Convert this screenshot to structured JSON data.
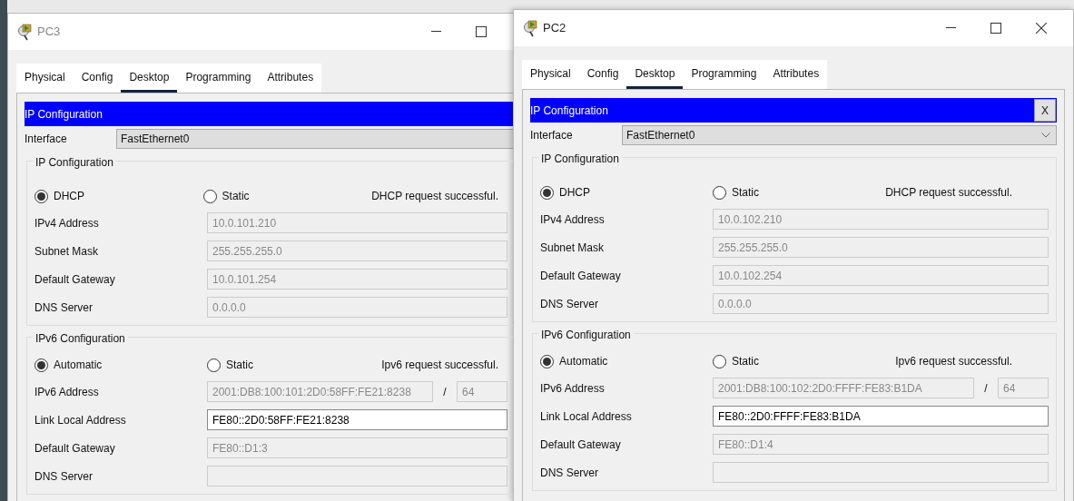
{
  "windows": [
    {
      "title": "PC3",
      "controls": [
        {
          "kind": "minimize"
        },
        {
          "kind": "maximize"
        }
      ],
      "tabs": [
        {
          "label": "Physical",
          "selected": false
        },
        {
          "label": "Config",
          "selected": false
        },
        {
          "label": "Desktop",
          "selected": true
        },
        {
          "label": "Programming",
          "selected": false
        },
        {
          "label": "Attributes",
          "selected": false
        }
      ],
      "panel": {
        "title": "IP Configuration",
        "interface_label": "Interface",
        "interface_value": "FastEthernet0",
        "dropdown": false,
        "ipv4": {
          "legend": "IP Configuration",
          "modes": [
            {
              "label": "DHCP",
              "selected": true
            },
            {
              "label": "Static",
              "selected": false
            }
          ],
          "status": "DHCP request successful.",
          "fields": [
            {
              "label": "IPv4 Address",
              "value": "10.0.101.210",
              "disabled": true
            },
            {
              "label": "Subnet Mask",
              "value": "255.255.255.0",
              "disabled": true
            },
            {
              "label": "Default Gateway",
              "value": "10.0.101.254",
              "disabled": true
            },
            {
              "label": "DNS Server",
              "value": "0.0.0.0",
              "disabled": true
            }
          ]
        },
        "ipv6": {
          "legend": "IPv6 Configuration",
          "modes": [
            {
              "label": "Automatic",
              "selected": true
            },
            {
              "label": "Static",
              "selected": false
            }
          ],
          "status": "Ipv6 request successful.",
          "fields": [
            {
              "label": "IPv6 Address",
              "value": "2001:DB8:100:101:2D0:58FF:FE21:8238",
              "disabled": true,
              "separator": "/",
              "prefix": "64"
            },
            {
              "label": "Link Local Address",
              "value": "FE80::2D0:58FF:FE21:8238",
              "disabled": false
            },
            {
              "label": "Default Gateway",
              "value": "FE80::D1:3",
              "disabled": true
            },
            {
              "label": "DNS Server",
              "disabled": true
            }
          ]
        }
      }
    },
    {
      "title": "PC2",
      "controls": [
        {
          "kind": "minimize"
        },
        {
          "kind": "maximize"
        },
        {
          "kind": "close"
        }
      ],
      "tabs": [
        {
          "label": "Physical",
          "selected": false
        },
        {
          "label": "Config",
          "selected": false
        },
        {
          "label": "Desktop",
          "selected": true
        },
        {
          "label": "Programming",
          "selected": false
        },
        {
          "label": "Attributes",
          "selected": false
        }
      ],
      "panel": {
        "title": "IP Configuration",
        "close_label": "X",
        "interface_label": "Interface",
        "interface_value": "FastEthernet0",
        "dropdown": true,
        "ipv4": {
          "legend": "IP Configuration",
          "modes": [
            {
              "label": "DHCP",
              "selected": true
            },
            {
              "label": "Static",
              "selected": false
            }
          ],
          "status": "DHCP request successful.",
          "fields": [
            {
              "label": "IPv4 Address",
              "value": "10.0.102.210",
              "disabled": true
            },
            {
              "label": "Subnet Mask",
              "value": "255.255.255.0",
              "disabled": true
            },
            {
              "label": "Default Gateway",
              "value": "10.0.102.254",
              "disabled": true
            },
            {
              "label": "DNS Server",
              "value": "0.0.0.0",
              "disabled": true
            }
          ]
        },
        "ipv6": {
          "legend": "IPv6 Configuration",
          "modes": [
            {
              "label": "Automatic",
              "selected": true
            },
            {
              "label": "Static",
              "selected": false
            }
          ],
          "status": "Ipv6 request successful.",
          "fields": [
            {
              "label": "IPv6 Address",
              "value": "2001:DB8:100:102:2D0:FFFF:FE83:B1DA",
              "disabled": true,
              "separator": "/",
              "prefix": "64"
            },
            {
              "label": "Link Local Address",
              "value": "FE80::2D0:FFFF:FE83:B1DA",
              "disabled": false
            },
            {
              "label": "Default Gateway",
              "value": "FE80::D1:4",
              "disabled": true
            },
            {
              "label": "DNS Server",
              "disabled": true
            }
          ]
        }
      }
    }
  ]
}
